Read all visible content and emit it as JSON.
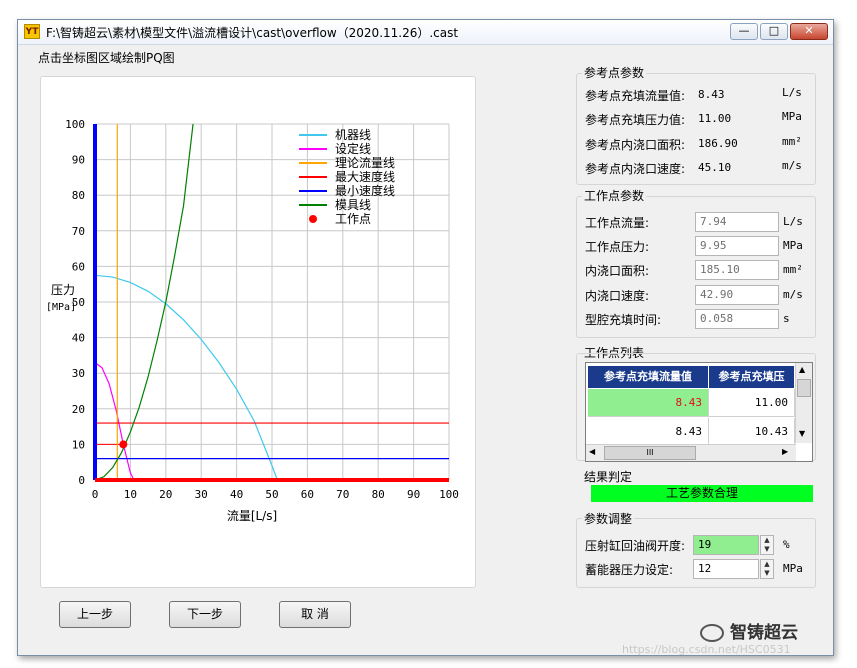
{
  "window": {
    "title": "F:\\智铸超云\\素材\\模型文件\\溢流槽设计\\cast\\overflow（2020.11.26）.cast",
    "icon_text": "YT",
    "controls": [
      "minimize-icon",
      "maximize-icon",
      "close-icon"
    ]
  },
  "plot_hint": "点击坐标图区域绘制PQ图",
  "chart_data": {
    "type": "line",
    "xlabel": "流量[L/s]",
    "ylabel": "压力",
    "ylabel_unit": "[MPa]",
    "xlim": [
      0,
      100
    ],
    "ylim": [
      0,
      100
    ],
    "x_ticks": [
      "0",
      "10",
      "20",
      "30",
      "40",
      "50",
      "60",
      "70",
      "80",
      "90",
      "100"
    ],
    "y_ticks": [
      "0",
      "10",
      "20",
      "30",
      "40",
      "50",
      "60",
      "70",
      "80",
      "90",
      "100"
    ],
    "grid": true,
    "legend_position": "top-right",
    "series": [
      {
        "name": "机器线",
        "color": "#41c8ee",
        "x": [
          0,
          5,
          10,
          15,
          20,
          25,
          30,
          35,
          40,
          45,
          50,
          51.5
        ],
        "y": [
          57.5,
          57,
          55.5,
          53,
          49.5,
          45,
          39.5,
          33,
          25.5,
          16.5,
          4,
          0
        ]
      },
      {
        "name": "设定线",
        "color": "#ff00ff",
        "x": [
          0,
          2,
          4,
          6,
          8,
          10,
          11
        ],
        "y": [
          33,
          31.5,
          27,
          19.5,
          10,
          2,
          0
        ]
      },
      {
        "name": "理论流量线",
        "color": "#ffa500",
        "x": [
          6.3,
          6.3
        ],
        "y": [
          0,
          100
        ]
      },
      {
        "name": "最大速度线",
        "color": "#ff0000",
        "x": [
          0,
          100
        ],
        "y": [
          16,
          16
        ]
      },
      {
        "name": "最小速度线",
        "color": "#0000ff",
        "x": [
          0,
          100
        ],
        "y": [
          6,
          6
        ]
      },
      {
        "name": "模具线",
        "color": "#008000",
        "x": [
          0,
          2.5,
          5,
          7.5,
          10,
          12.5,
          15,
          17.5,
          20,
          22.5,
          25,
          27.7
        ],
        "y": [
          0,
          0.9,
          3.5,
          7.7,
          13.5,
          20.5,
          29,
          39,
          50,
          63,
          77,
          100
        ]
      }
    ],
    "axis_lines": [
      {
        "color": "#0000ff",
        "axis": "x=0"
      },
      {
        "color": "#ff0000",
        "axis": "y=0"
      }
    ],
    "guide_lines": [
      {
        "color": "#ff0000",
        "x": [
          0,
          8
        ],
        "y": [
          10,
          10
        ]
      }
    ],
    "points": [
      {
        "name": "工作点",
        "x": 8,
        "y": 10,
        "color": "#ff0000"
      }
    ]
  },
  "ref_params": {
    "title": "参考点参数",
    "rows": [
      {
        "label": "参考点充填流量值:",
        "value": "8.43",
        "unit": "L/s"
      },
      {
        "label": "参考点充填压力值:",
        "value": "11.00",
        "unit": "MPa"
      },
      {
        "label": "参考点内浇口面积:",
        "value": "186.90",
        "unit": "mm²"
      },
      {
        "label": "参考点内浇口速度:",
        "value": "45.10",
        "unit": "m/s"
      }
    ]
  },
  "work_params": {
    "title": "工作点参数",
    "rows": [
      {
        "label": "工作点流量:",
        "value": "7.94",
        "unit": "L/s"
      },
      {
        "label": "工作点压力:",
        "value": "9.95",
        "unit": "MPa"
      },
      {
        "label": "内浇口面积:",
        "value": "185.10",
        "unit": "mm²"
      },
      {
        "label": "内浇口速度:",
        "value": "42.90",
        "unit": "m/s"
      },
      {
        "label": "型腔充填时间:",
        "value": "0.058",
        "unit": "s"
      }
    ]
  },
  "work_list": {
    "title": "工作点列表",
    "columns": [
      "参考点充填流量值",
      "参考点充填压"
    ],
    "rows": [
      [
        "8.43",
        "11.00"
      ],
      [
        "8.43",
        "10.43"
      ]
    ],
    "selected_row_color": "#90ee90",
    "scroll_icons": [
      "scroll-up-icon",
      "scroll-down-icon",
      "scroll-left-icon",
      "scroll-right-icon"
    ],
    "hscroll_grip": "III"
  },
  "result": {
    "title": "结果判定",
    "text": "工艺参数合理",
    "color": "#00ff21"
  },
  "adjust": {
    "title": "参数调整",
    "rows": [
      {
        "label": "压射缸回油阀开度:",
        "value": "19",
        "unit": "%"
      },
      {
        "label": "蓄能器压力设定:",
        "value": "12",
        "unit": "MPa"
      }
    ]
  },
  "buttons": {
    "prev": "上一步",
    "next": "下一步",
    "cancel": "取 消"
  },
  "watermark": {
    "brand": "智铸超云",
    "url": "https://blog.csdn.net/HSC0531"
  }
}
